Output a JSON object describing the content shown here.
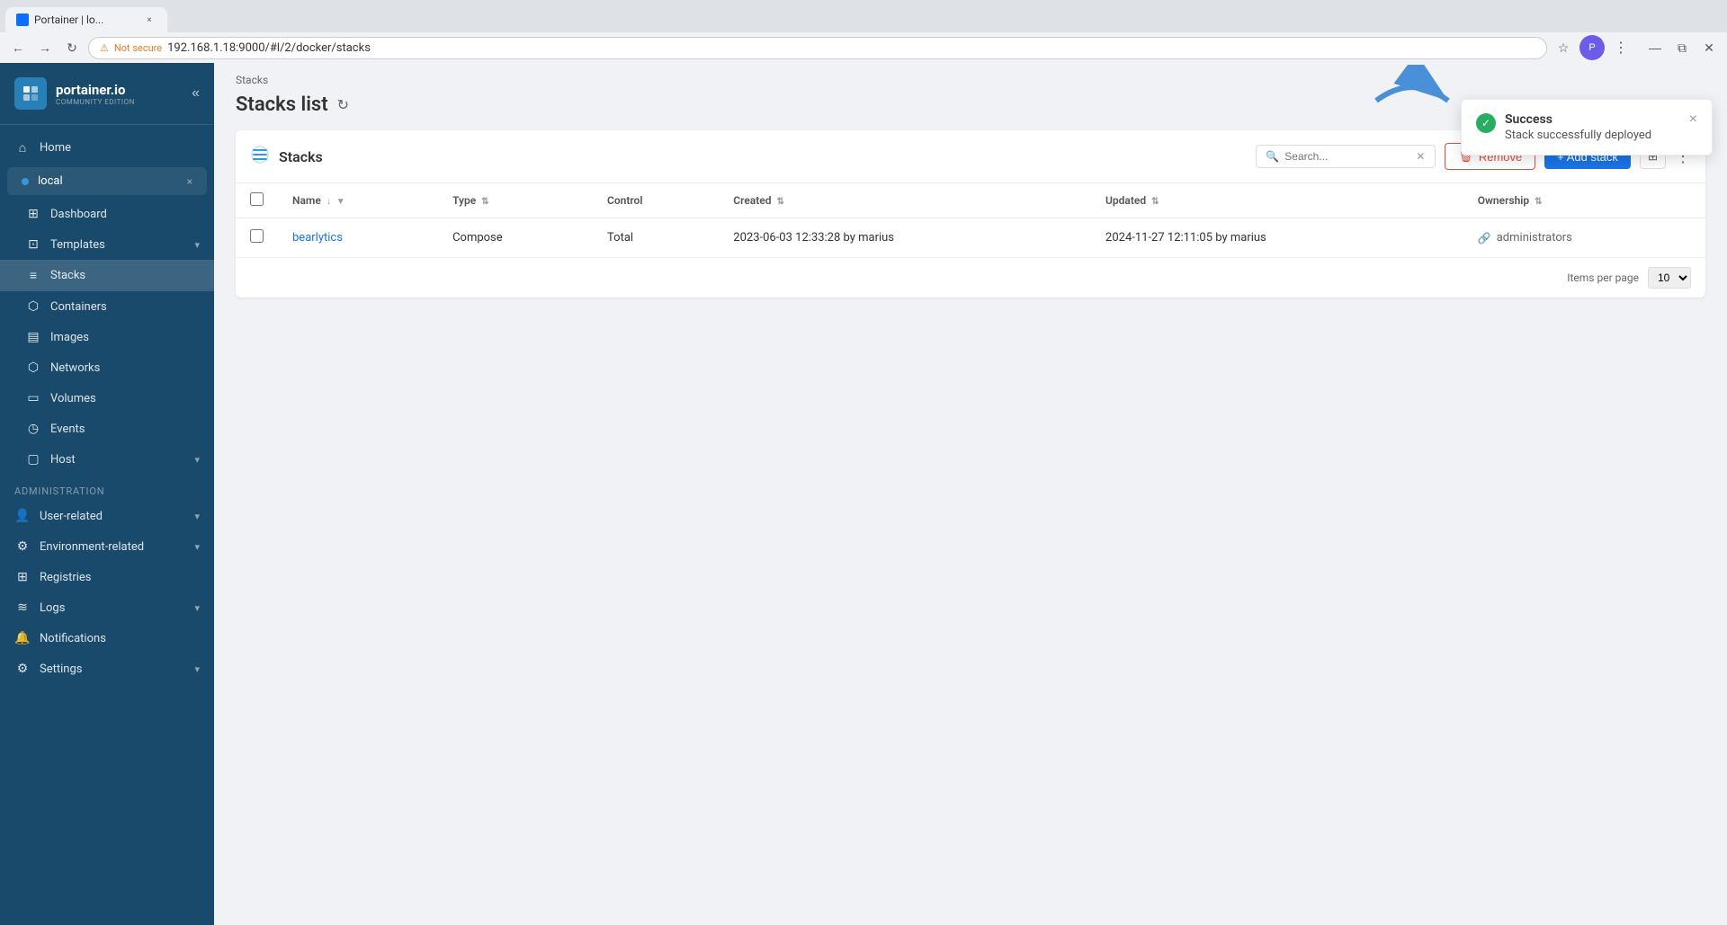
{
  "browser": {
    "tab_title": "Portainer | lo...",
    "address": "192.168.1.18:9000/#l/2/docker/stacks",
    "security_label": "Not secure"
  },
  "sidebar": {
    "logo_text": "portainer.io",
    "logo_subtitle": "COMMUNITY EDITION",
    "collapse_icon": "«",
    "home_label": "Home",
    "env_label": "local",
    "env_close": "×",
    "dashboard_label": "Dashboard",
    "templates_label": "Templates",
    "stacks_label": "Stacks",
    "containers_label": "Containers",
    "images_label": "Images",
    "networks_label": "Networks",
    "volumes_label": "Volumes",
    "events_label": "Events",
    "host_label": "Host",
    "admin_section": "Administration",
    "user_related_label": "User-related",
    "env_related_label": "Environment-related",
    "registries_label": "Registries",
    "logs_label": "Logs",
    "notifications_label": "Notifications",
    "settings_label": "Settings"
  },
  "breadcrumb": "Stacks",
  "page_title": "Stacks list",
  "panel": {
    "title": "Stacks",
    "search_placeholder": "Search...",
    "remove_label": "Remove",
    "add_label": "+ Add stack",
    "items_per_page_label": "Items per page",
    "items_per_page_value": "10"
  },
  "table": {
    "columns": [
      "Name",
      "Type",
      "Control",
      "Created",
      "Updated",
      "Ownership"
    ],
    "rows": [
      {
        "name": "bearlytics",
        "type": "Compose",
        "control": "Total",
        "created": "2023-06-03 12:33:28 by marius",
        "updated": "2024-11-27 12:11:05 by marius",
        "ownership": "administrators"
      }
    ]
  },
  "toast": {
    "title": "Success",
    "message": "Stack successfully deployed",
    "close_icon": "×"
  }
}
